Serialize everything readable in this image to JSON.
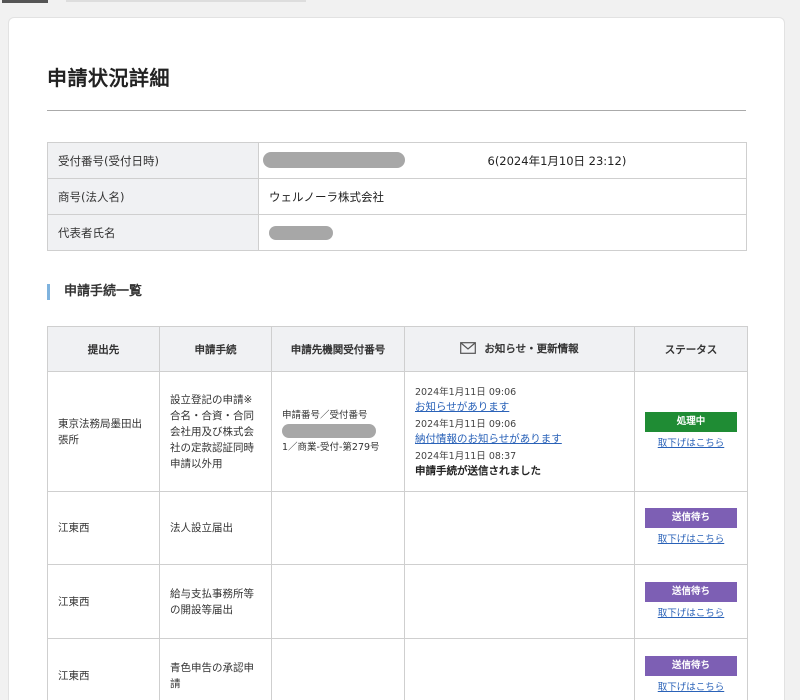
{
  "page": {
    "title": "申請状況詳細"
  },
  "summary": {
    "receipt_label": "受付番号(受付日時)",
    "receipt_value_visible": "・1 011…6(2024年1月10日 23:12)",
    "receipt_value_tail": "6(2024年1月10日 23:12)",
    "company_label": "商号(法人名)",
    "company_value": "ウェルノーラ株式会社",
    "representative_label": "代表者氏名"
  },
  "section": {
    "title": "申請手続一覧"
  },
  "table": {
    "headers": {
      "destination": "提出先",
      "procedure": "申請手続",
      "agency_number": "申請先機関受付番号",
      "notices": "お知らせ・更新情報",
      "status": "ステータス"
    },
    "rows": [
      {
        "destination": "東京法務局墨田出張所",
        "procedure": "設立登記の申請※合名・合資・合同会社用及び株式会社の定款認証同時申請以外用",
        "agency_number_label": "申請番号／受付番号",
        "agency_number_tail": "1／商業-受付-第279号",
        "notices": [
          {
            "date": "2024年1月11日 09:06",
            "text": "お知らせがあります"
          },
          {
            "date": "2024年1月11日 09:06",
            "text": "納付情報のお知らせがあります"
          },
          {
            "date": "2024年1月11日 08:37",
            "text": "申請手続が送信されました"
          }
        ],
        "status": "処理中",
        "withdraw": "取下げはこちら"
      },
      {
        "destination": "江東西",
        "procedure": "法人設立届出",
        "status": "送信待ち",
        "withdraw": "取下げはこちら"
      },
      {
        "destination": "江東西",
        "procedure": "給与支払事務所等の開設等届出",
        "status": "送信待ち",
        "withdraw": "取下げはこちら"
      },
      {
        "destination": "江東西",
        "procedure": "青色申告の承認申請",
        "status": "送信待ち",
        "withdraw": "取下げはこちら"
      }
    ]
  },
  "colors": {
    "status_processing": "#1f8c34",
    "status_waiting": "#7d5fb4",
    "link": "#2a62b8",
    "section_accent": "#7fb3de"
  },
  "icons": {
    "notices_header": "mail-icon"
  }
}
